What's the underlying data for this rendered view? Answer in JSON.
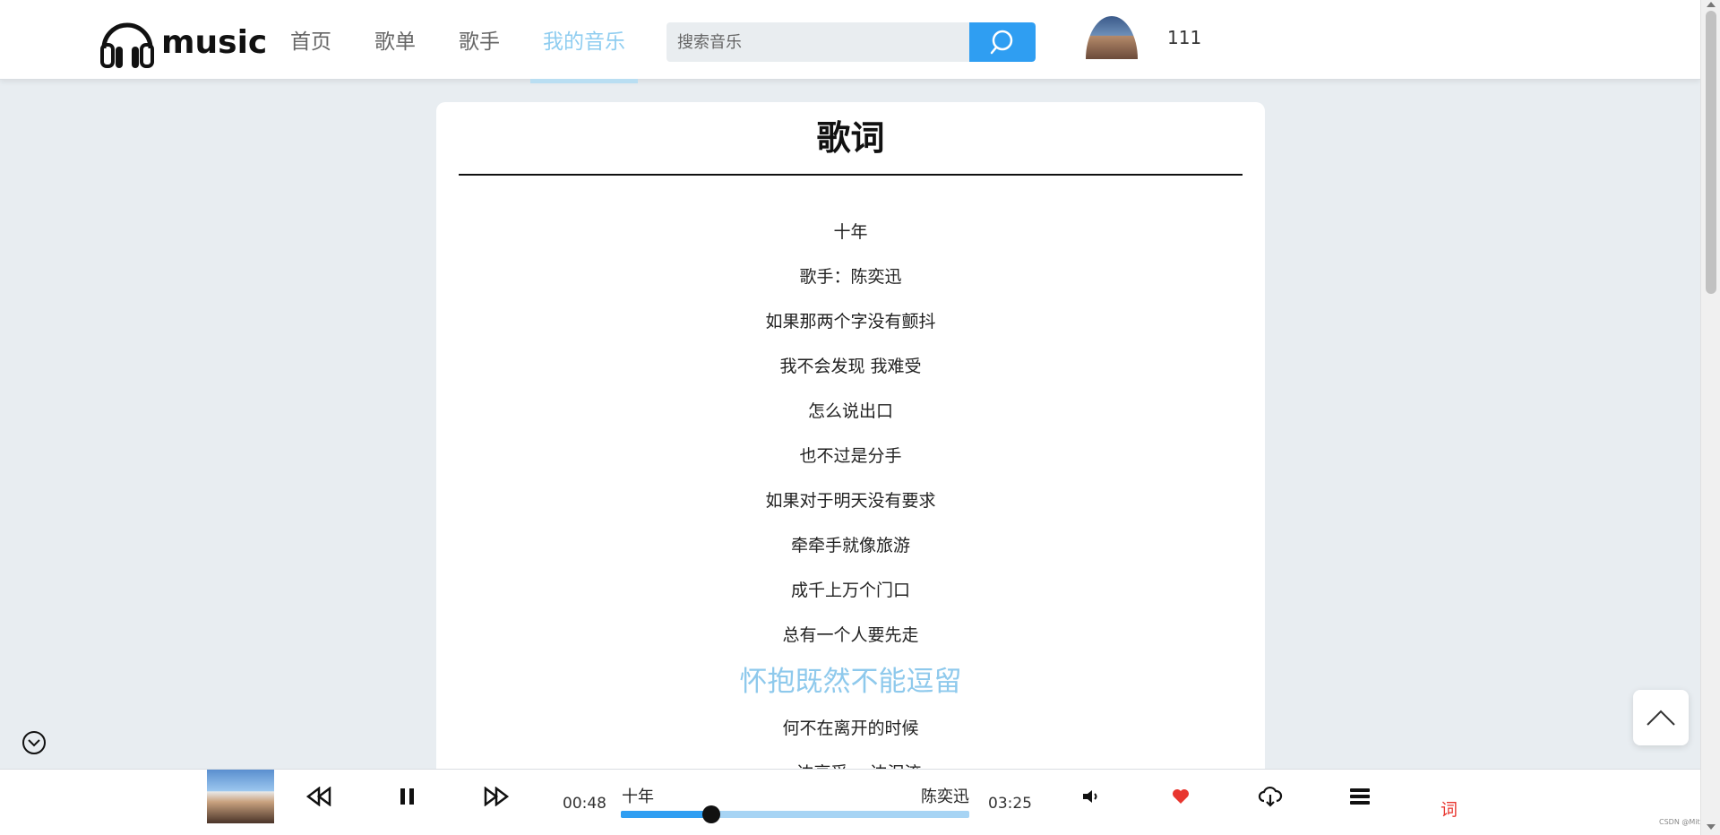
{
  "header": {
    "logo_text": "music",
    "nav": [
      {
        "label": "首页",
        "active": false
      },
      {
        "label": "歌单",
        "active": false
      },
      {
        "label": "歌手",
        "active": false
      },
      {
        "label": "我的音乐",
        "active": true
      }
    ],
    "search": {
      "placeholder": "搜索音乐",
      "value": ""
    },
    "user": {
      "name": "111"
    }
  },
  "lyrics_panel": {
    "title": "歌词",
    "lines": [
      "十年",
      "歌手：陈奕迅",
      "如果那两个字没有颤抖",
      "我不会发现 我难受",
      "怎么说出口",
      "也不过是分手",
      "如果对于明天没有要求",
      "牵牵手就像旅游",
      "成千上万个门口",
      "总有一个人要先走",
      "怀抱既然不能逗留",
      "何不在离开的时候",
      "一边享受 一边泪流"
    ],
    "current_line_index": 10
  },
  "player": {
    "song_name": "十年",
    "singer": "陈奕迅",
    "current_time": "00:48",
    "total_time": "03:25",
    "progress": 0.26,
    "lyric_button": "词",
    "liked": true
  },
  "watermark": "CSDN @Mitt",
  "colors": {
    "accent": "#2f9ef2",
    "active_nav": "#8fcdf0",
    "current_lyric": "#8ec9ec",
    "like": "#e8362f",
    "background": "#e8edf1"
  },
  "icons": {
    "logo": "headphones-icon",
    "search": "search-icon",
    "collapse": "chevron-down-circle-icon",
    "back_to_top": "chevron-up-icon",
    "prev": "rewind-icon",
    "play_pause": "pause-icon",
    "next": "fast-forward-icon",
    "volume": "volume-icon",
    "like": "heart-icon",
    "download": "cloud-download-icon",
    "playlist": "list-icon"
  }
}
